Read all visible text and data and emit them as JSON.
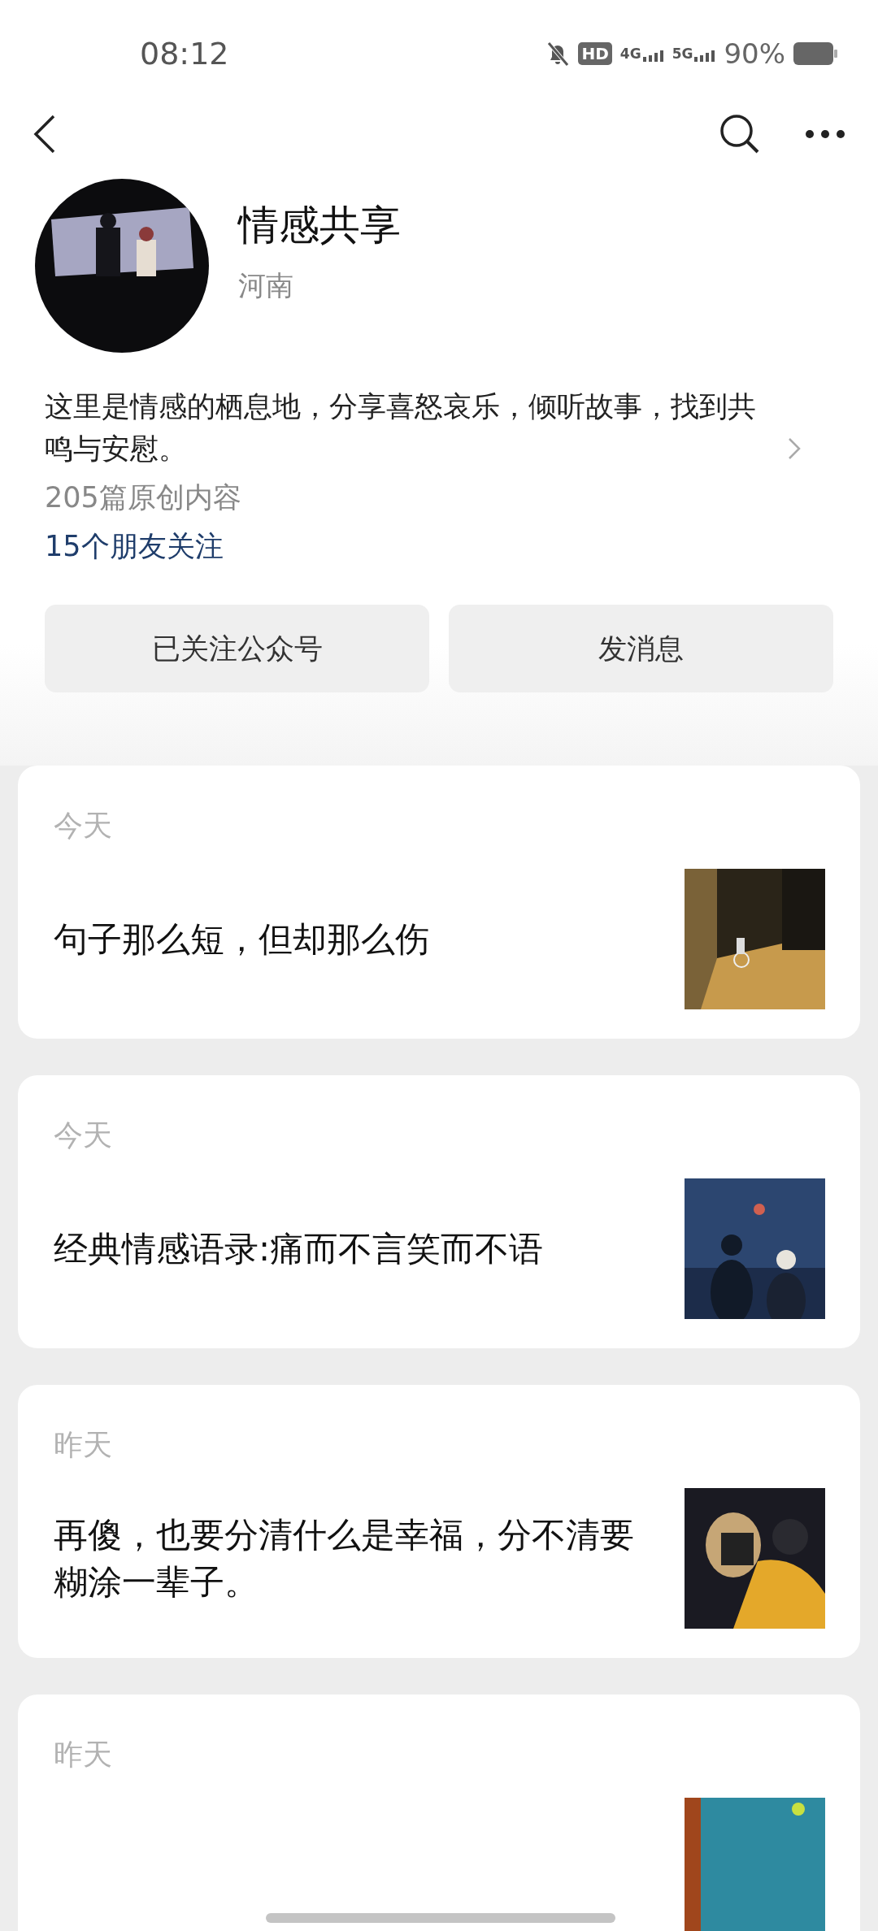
{
  "status_bar": {
    "time": "08:12",
    "network_labels": [
      "HD",
      "4G",
      "5G"
    ],
    "battery": "90%"
  },
  "profile": {
    "name": "情感共享",
    "region": "河南",
    "description": "这里是情感的栖息地，分享喜怒哀乐，倾听故事，找到共鸣与安慰。",
    "article_count": "205篇原创内容",
    "friends_following": "15个朋友关注"
  },
  "buttons": [
    {
      "label": "已关注公众号"
    },
    {
      "label": "发消息"
    }
  ],
  "articles": [
    {
      "date": "今天",
      "title": "句子那么短，但却那么伤"
    },
    {
      "date": "今天",
      "title": "经典情感语录:痛而不言笑而不语"
    },
    {
      "date": "昨天",
      "title": "再傻，也要分清什么是幸福，分不清要糊涂一辈子。"
    },
    {
      "date": "昨天"
    }
  ]
}
